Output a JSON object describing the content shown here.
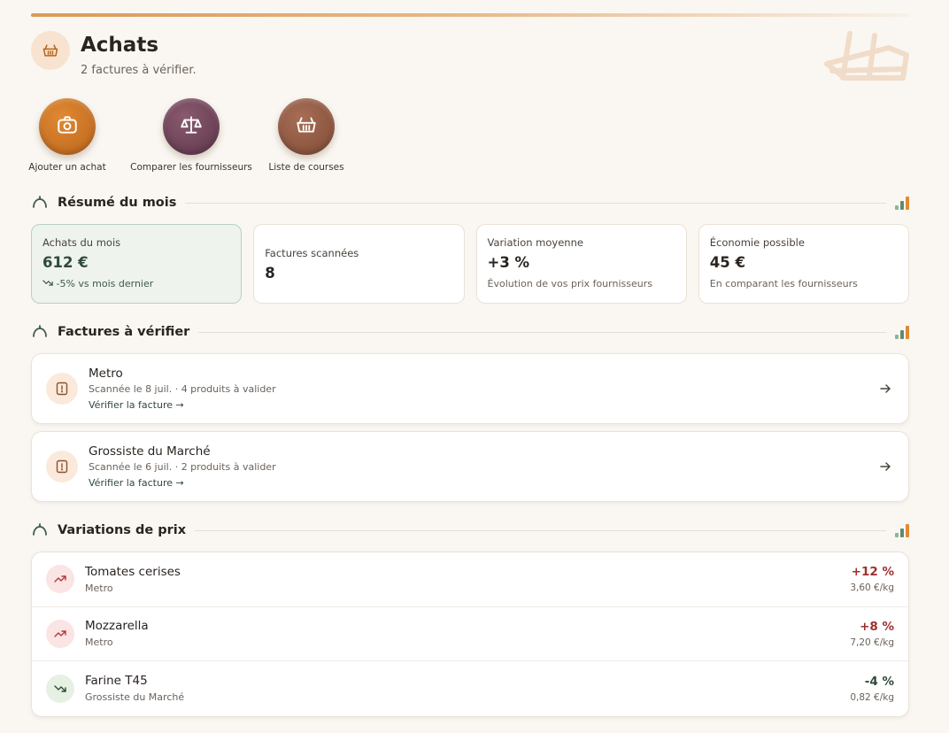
{
  "header": {
    "title": "Achats",
    "subtitle": "2 factures à vérifier.",
    "icon": "basket-icon"
  },
  "actions": [
    {
      "label": "Ajouter un achat",
      "icon": "camera-icon",
      "color": "#c8731f"
    },
    {
      "label": "Comparer les fournisseurs",
      "icon": "scale-icon",
      "color": "#6e4257"
    },
    {
      "label": "Liste de courses",
      "icon": "basket-icon",
      "color": "#8f5a45"
    }
  ],
  "sections": {
    "summary": "Résumé du mois",
    "invoices": "Factures à vérifier",
    "prices": "Variations de prix"
  },
  "stats": [
    {
      "label": "Achats du mois",
      "value": "612 €",
      "note": "-5% vs mois dernier",
      "icon": "trend-down-icon"
    },
    {
      "label": "Factures scannées",
      "value": "8"
    },
    {
      "label": "Variation moyenne",
      "value": "+3 %",
      "note": "Évolution de vos prix fournisseurs"
    },
    {
      "label": "Économie possible",
      "value": "45 €",
      "note": "En comparant les fournisseurs"
    }
  ],
  "invoices": [
    {
      "name": "Metro",
      "meta": "Scannée le 8 juil. · 4 produits à valider",
      "link": "Vérifier la facture →"
    },
    {
      "name": "Grossiste du Marché",
      "meta": "Scannée le 6 juil. · 2 produits à valider",
      "link": "Vérifier la facture →"
    }
  ],
  "prices": [
    {
      "name": "Tomates cerises",
      "supplier": "Metro",
      "change": "+12 %",
      "unit": "3,60 €/kg",
      "trend": "up"
    },
    {
      "name": "Mozzarella",
      "supplier": "Metro",
      "change": "+8 %",
      "unit": "7,20 €/kg",
      "trend": "up"
    },
    {
      "name": "Farine T45",
      "supplier": "Grossiste du Marché",
      "change": "-4 %",
      "unit": "0,82 €/kg",
      "trend": "down"
    }
  ],
  "colors": {
    "accent": "#c8731f",
    "green": "#2f4a3a",
    "up": "#9e2f2f",
    "down": "#2f4a3a"
  }
}
